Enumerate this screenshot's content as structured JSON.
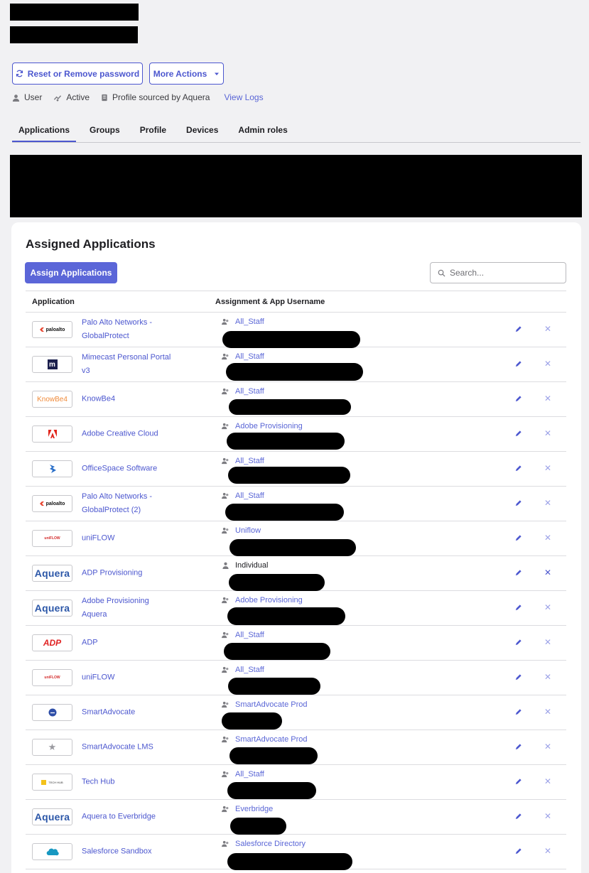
{
  "header": {
    "reset_label": "Reset or Remove password",
    "more_actions_label": "More Actions"
  },
  "meta": {
    "user_label": "User",
    "status_label": "Active",
    "profile_source": "Profile sourced by Aquera",
    "view_logs": "View Logs"
  },
  "tabs": [
    "Applications",
    "Groups",
    "Profile",
    "Devices",
    "Admin roles"
  ],
  "card": {
    "title": "Assigned Applications",
    "assign_button": "Assign Applications",
    "search_placeholder": "Search..."
  },
  "table": {
    "columns": [
      "Application",
      "Assignment & App Username"
    ],
    "rows": [
      {
        "logo": "paloalto-logo",
        "app": "Palo Alto Networks - GlobalProtect",
        "assignment": "All_Staff"
      },
      {
        "logo": "mimecast-logo",
        "app": "Mimecast Personal Portal v3",
        "assignment": "All_Staff"
      },
      {
        "logo": "knowbe4-logo",
        "app": "KnowBe4",
        "assignment": "All_Staff"
      },
      {
        "logo": "adobe-logo",
        "app": "Adobe Creative Cloud",
        "assignment": "Adobe Provisioning"
      },
      {
        "logo": "officespace-logo",
        "app": "OfficeSpace Software",
        "assignment": "All_Staff"
      },
      {
        "logo": "paloalto-logo",
        "app": "Palo Alto Networks - GlobalProtect (2)",
        "assignment": "All_Staff"
      },
      {
        "logo": "uniflow-logo",
        "app": "uniFLOW",
        "assignment": "Uniflow"
      },
      {
        "logo": "aquera-logo",
        "app": "ADP Provisioning",
        "assignment": "Individual"
      },
      {
        "logo": "aquera-logo",
        "app": "Adobe Provisioning Aquera",
        "assignment": "Adobe Provisioning"
      },
      {
        "logo": "adp-logo",
        "app": "ADP",
        "assignment": "All_Staff"
      },
      {
        "logo": "uniflow-logo",
        "app": "uniFLOW",
        "assignment": "All_Staff"
      },
      {
        "logo": "smartadvocate-logo",
        "app": "SmartAdvocate",
        "assignment": "SmartAdvocate Prod"
      },
      {
        "logo": "star-logo",
        "app": "SmartAdvocate LMS",
        "assignment": "SmartAdvocate Prod"
      },
      {
        "logo": "techhub-logo",
        "app": "Tech Hub",
        "assignment": "All_Staff"
      },
      {
        "logo": "aquera-logo",
        "app": "Aquera to Everbridge",
        "assignment": "Everbridge"
      },
      {
        "logo": "salesforce-logo",
        "app": "Salesforce Sandbox",
        "assignment": "Salesforce Directory"
      }
    ]
  },
  "logo_text": {
    "paloalto": "paloalto",
    "knowbe4": "KnowBe4",
    "aquera": "Aquera",
    "adp": "ADP",
    "uniflow": "uniFLOW",
    "techhub": "TECH HUB",
    "mimecast": "m"
  },
  "colors": {
    "accent": "#4c57cf",
    "primary_button": "#5b66d8",
    "link": "#5a66d6",
    "background": "#f1f1f3"
  }
}
